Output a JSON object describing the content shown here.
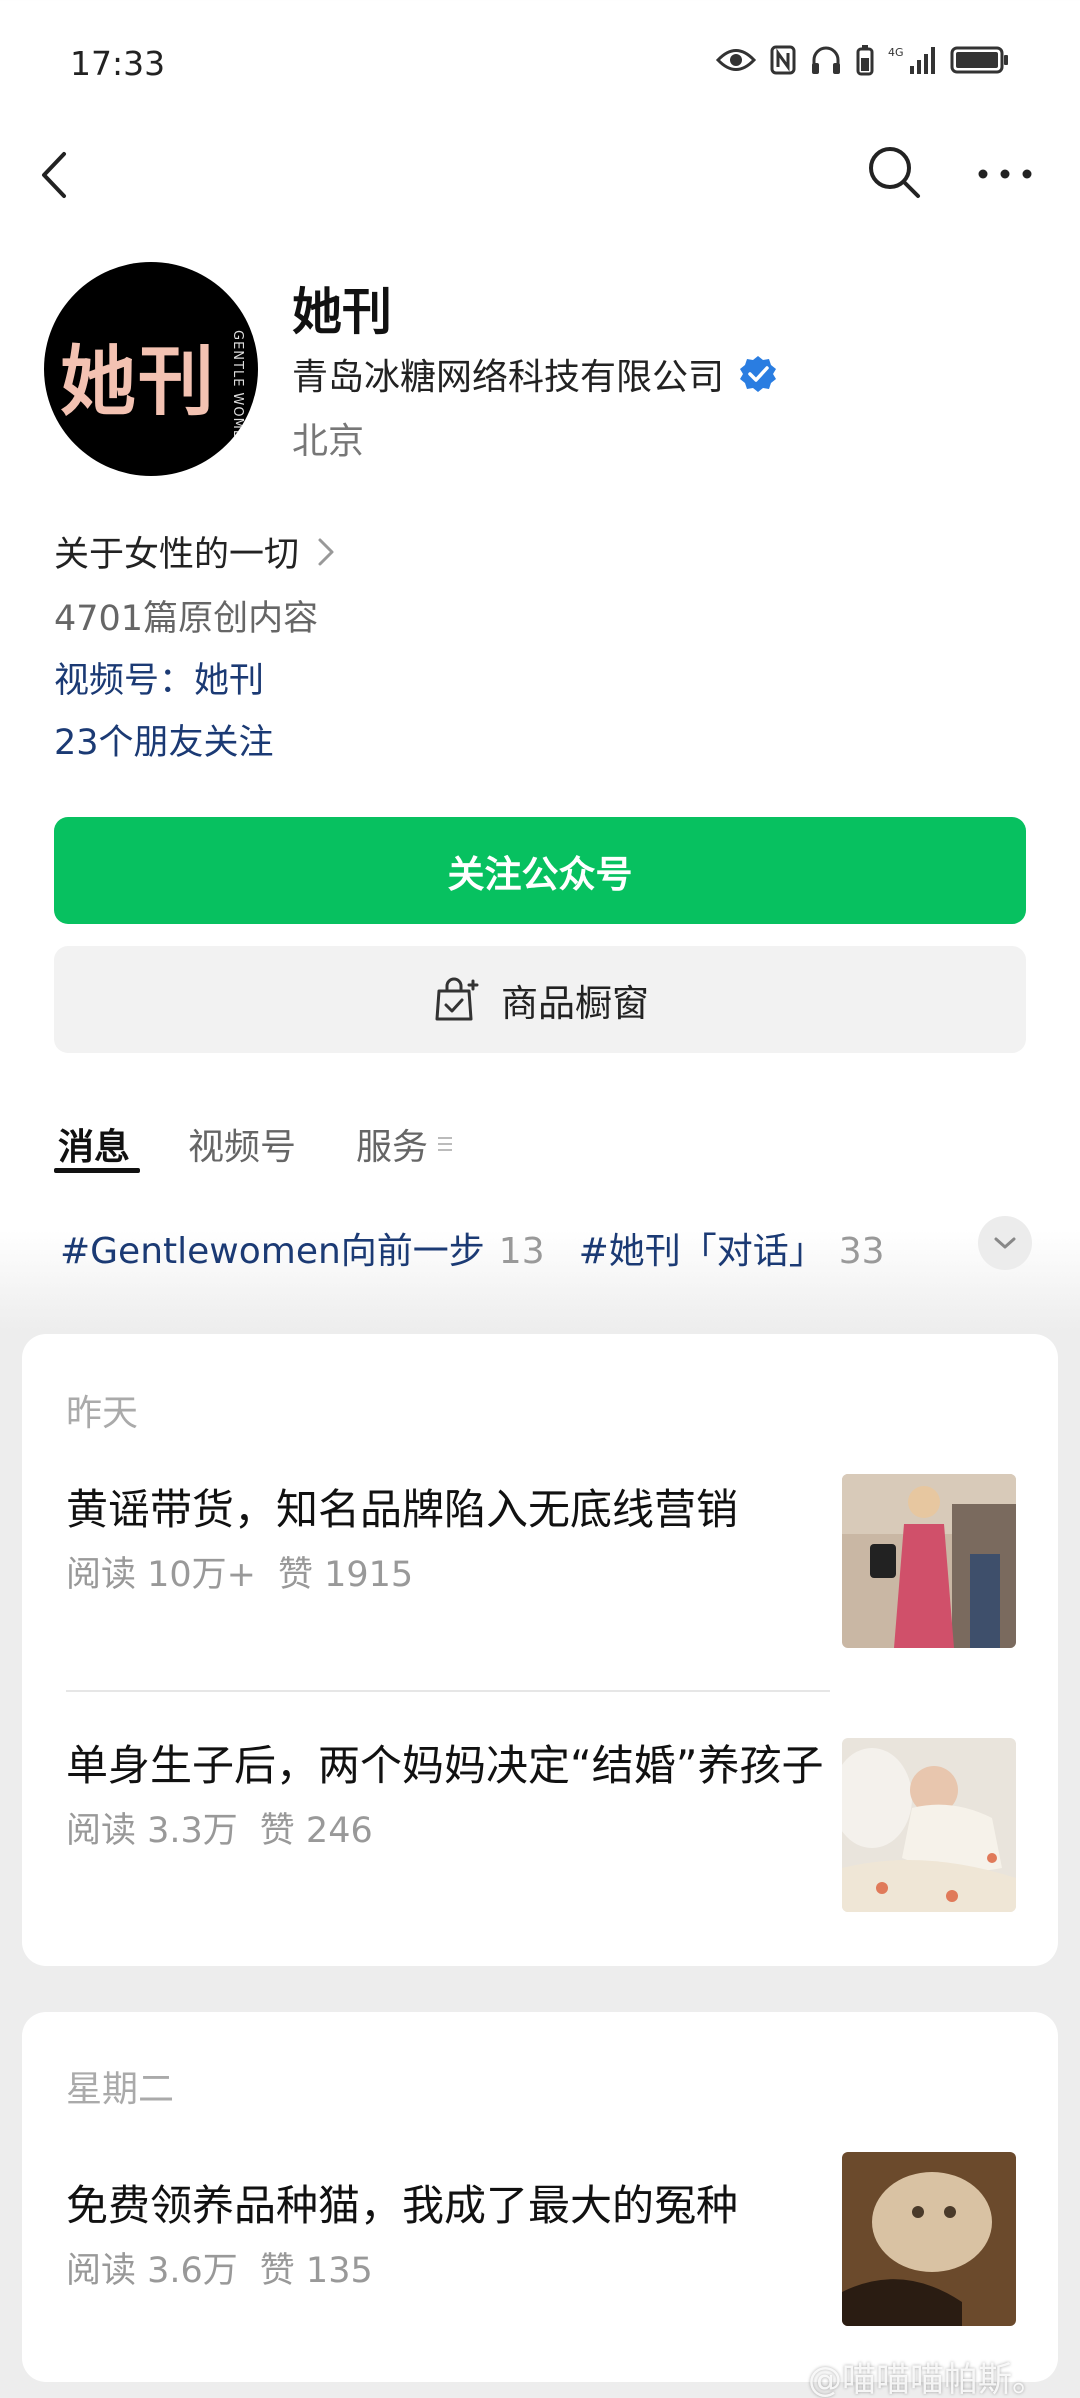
{
  "status_bar": {
    "time": "17:33",
    "icons": [
      "eye-icon",
      "nfc-icon",
      "headphones-icon",
      "battery-saver-icon",
      "4g-signal-icon",
      "battery-icon"
    ]
  },
  "nav": {
    "icons": [
      "back-chevron-icon",
      "search-icon",
      "more-icon"
    ]
  },
  "account": {
    "avatar_text": "她刊",
    "avatar_subtext": "GENTLE WOMEN",
    "name": "她刊",
    "company": "青岛冰糖网络科技有限公司",
    "location": "北京",
    "intro": "关于女性的一切",
    "articles_count": "4701篇原创内容",
    "channels": "视频号：她刊",
    "friends_following": "23个朋友关注"
  },
  "buttons": {
    "follow": "关注公众号",
    "shop": "商品橱窗"
  },
  "tabs": [
    {
      "label": "消息"
    },
    {
      "label": "视频号"
    },
    {
      "label": "服务"
    }
  ],
  "hashtags": [
    {
      "name": "#Gentlewomen向前一步",
      "count": "13"
    },
    {
      "name": "#她刊「对话」",
      "count": "33"
    }
  ],
  "feed": {
    "groups": [
      {
        "day": "昨天",
        "articles": [
          {
            "title": "黄谣带货，知名品牌陷入无底线营销",
            "reads": "阅读 10万+",
            "likes": "赞 1915"
          },
          {
            "title": "单身生子后，两个妈妈决定“结婚”养孩子",
            "reads": "阅读 3.3万",
            "likes": "赞 246"
          }
        ]
      },
      {
        "day": "星期二",
        "articles": [
          {
            "title": "免费领养品种猫，我成了最大的冤种",
            "reads": "阅读 3.6万",
            "likes": "赞 135"
          }
        ]
      }
    ]
  },
  "watermark": "@喵喵喵帕斯。",
  "colors": {
    "accent_green": "#07c160",
    "link_blue": "#1b3a74",
    "verified_blue": "#2a7de1"
  }
}
